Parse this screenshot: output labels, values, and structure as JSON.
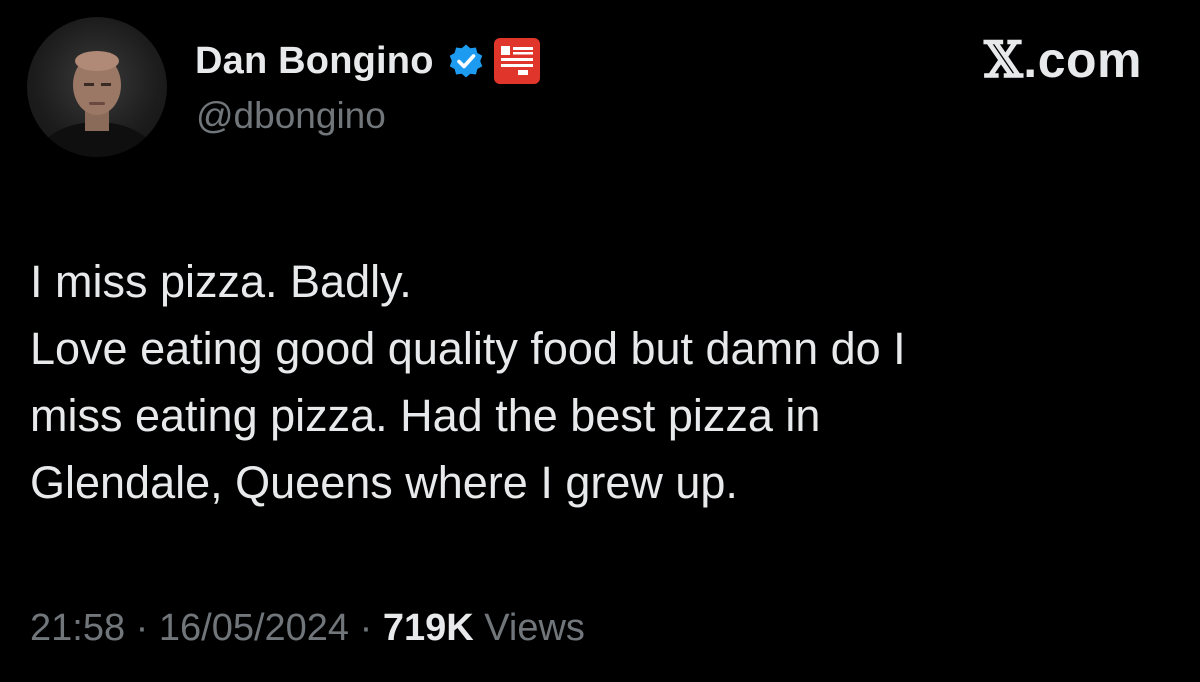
{
  "author": {
    "display_name": "Dan Bongino",
    "handle": "@dbongino",
    "verified": true,
    "verified_color": "#1d9bf0",
    "affiliate_badge_color": "#e0352b"
  },
  "brand": {
    "x_glyph": "𝕏",
    "suffix": ".com"
  },
  "tweet": {
    "lines": [
      "I miss pizza. Badly.",
      "Love eating good quality food but damn do I",
      "miss eating pizza. Had the best pizza in",
      "Glendale, Queens where I grew up."
    ]
  },
  "meta": {
    "time": "21:58",
    "separator": "·",
    "date": "16/05/2024",
    "views_count": "719K",
    "views_label": "Views"
  },
  "colors": {
    "background": "#000000",
    "primary_text": "#e7e9ea",
    "secondary_text": "#71767b"
  }
}
